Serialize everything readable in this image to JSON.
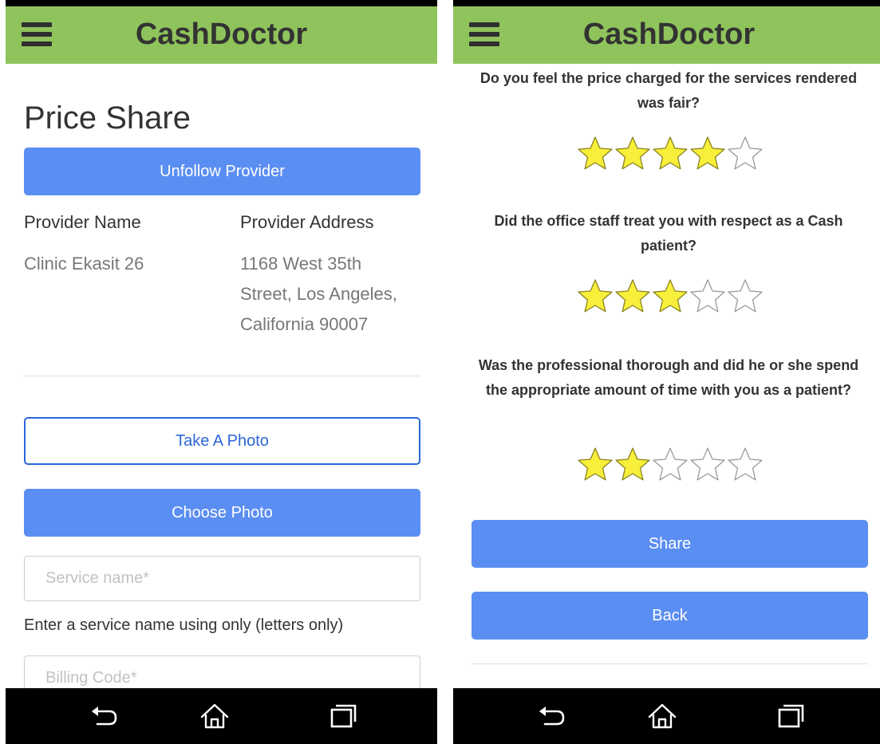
{
  "app": {
    "title": "CashDoctor"
  },
  "colors": {
    "header": "#8fc45c",
    "primary": "#5b8ef2",
    "star_filled": "#f8ef3a"
  },
  "left": {
    "page_title": "Price Share",
    "unfollow_label": "Unfollow Provider",
    "provider_name_header": "Provider Name",
    "provider_address_header": "Provider Address",
    "provider_name": "Clinic Ekasit 26",
    "provider_address_lines": [
      "1168 West 35th",
      "Street, Los Angeles,",
      "California 90007"
    ],
    "take_photo_label": "Take A Photo",
    "choose_photo_label": "Choose Photo",
    "service_placeholder": "Service name*",
    "service_help": "Enter a service name using only (letters only)",
    "billing_placeholder": "Billing Code*"
  },
  "right": {
    "questions": [
      {
        "text": "Do you feel the price charged for the services rendered was fair?",
        "rating": 4,
        "max": 5
      },
      {
        "text": "Did the office staff treat you with respect as a Cash patient?",
        "rating": 3,
        "max": 5
      },
      {
        "text": "Was the professional thorough and did he or she spend the appropriate amount of time with you as a patient?",
        "rating": 2,
        "max": 5
      }
    ],
    "share_label": "Share",
    "back_label": "Back"
  },
  "nav": {
    "icons": [
      "back-icon",
      "home-icon",
      "recent-apps-icon"
    ]
  }
}
